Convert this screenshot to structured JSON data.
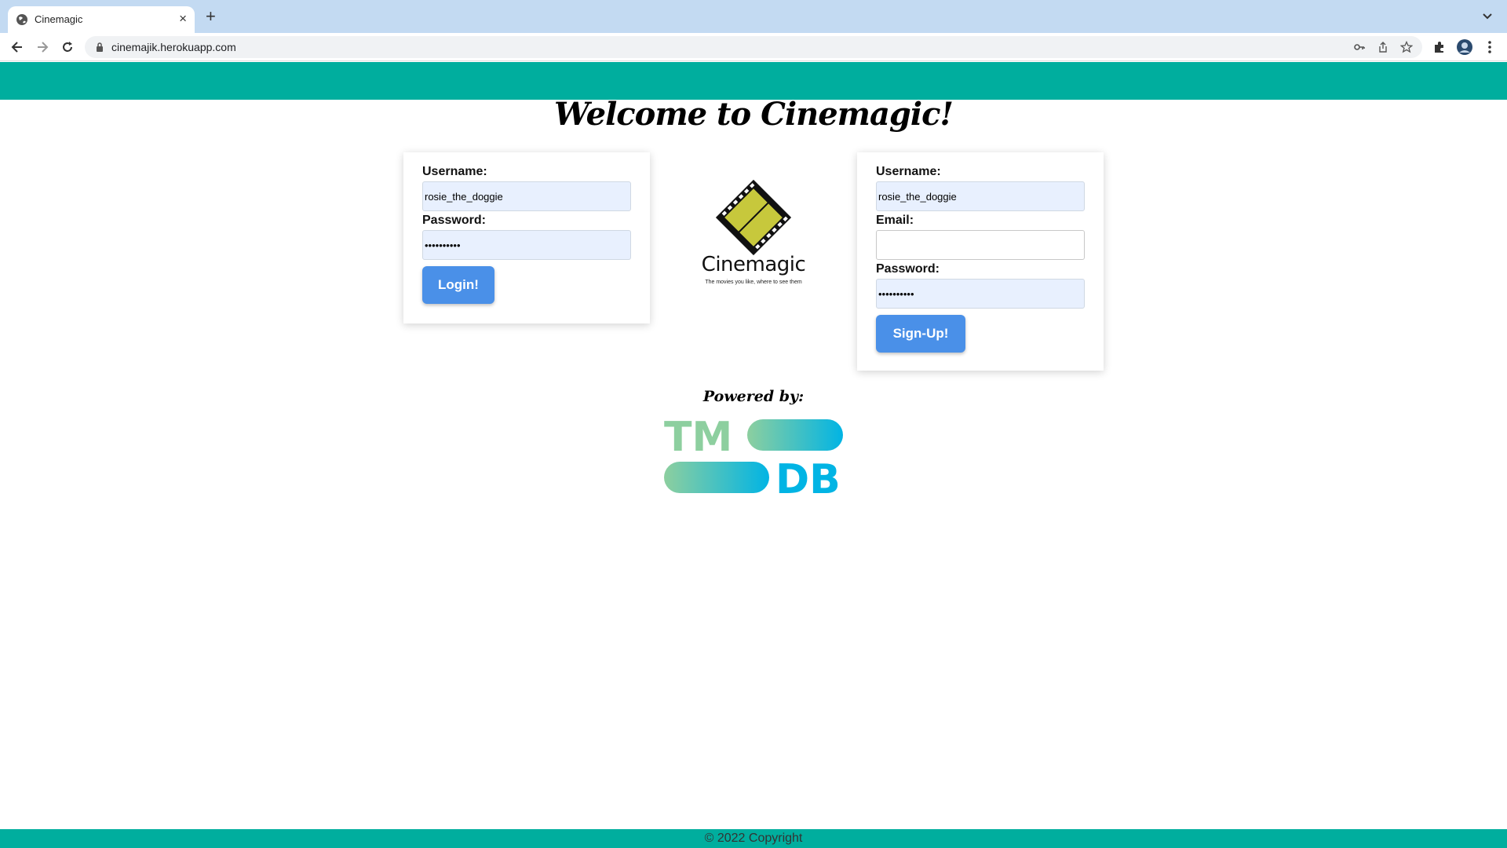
{
  "browser": {
    "tab_title": "Cinemagic",
    "new_tab_symbol": "+",
    "close_symbol": "×",
    "url": "cinemajik.herokuapp.com"
  },
  "page": {
    "welcome": "Welcome to Cinemagic!",
    "login": {
      "username_label": "Username:",
      "username_value": "rosie_the_doggie",
      "password_label": "Password:",
      "password_value": "••••••••••",
      "button": "Login!"
    },
    "logo": {
      "name": "Cinemagic",
      "tagline": "The movies you like, where to see them"
    },
    "signup": {
      "username_label": "Username:",
      "username_value": "rosie_the_doggie",
      "email_label": "Email:",
      "email_value": "",
      "password_label": "Password:",
      "password_value": "••••••••••",
      "button": "Sign-Up!"
    },
    "powered_by": "Powered by:",
    "tmdb": {
      "top_letters": "TM",
      "bottom_letters": "DB"
    },
    "footer": "© 2022 Copyright"
  },
  "colors": {
    "brand": "#00ae9e",
    "button": "#4a90e8",
    "logo_film": "#c7c83c",
    "tmdb_green": "#8dcf9f",
    "tmdb_blue": "#01b4e4"
  }
}
